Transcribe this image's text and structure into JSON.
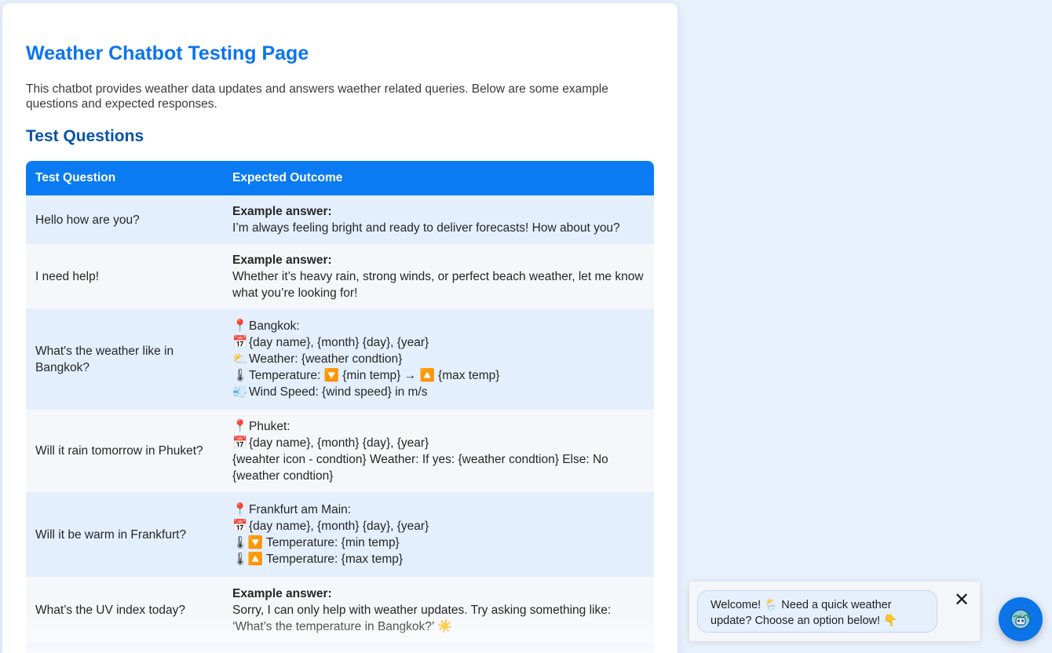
{
  "page": {
    "title": "Weather Chatbot Testing Page",
    "intro": "This chatbot provides weather data updates and answers waether related queries. Below are some example questions and expected responses.",
    "section_title": "Test Questions"
  },
  "table": {
    "headers": [
      "Test Question",
      "Expected Outcome"
    ],
    "rows": [
      {
        "question": "Hello how are you?",
        "answer_label": "Example answer:",
        "answer_lines": [
          "I’m always feeling bright and ready to deliver forecasts! How about you?"
        ]
      },
      {
        "question": "I need help!",
        "answer_label": "Example answer:",
        "answer_lines": [
          "Whether it’s heavy rain, strong winds, or perfect beach weather, let me know what you’re looking for!"
        ]
      },
      {
        "question": "What's the weather like in Bangkok?",
        "answer_lines": [
          {
            "icon": "📍",
            "text": "Bangkok:"
          },
          {
            "icon": "📅",
            "text": "{day name}, {month} {day}, {year}"
          },
          {
            "icon": "⛅",
            "text": "Weather: {weather condtion}"
          },
          {
            "icon": "🌡",
            "text": "Temperature: 🔽 {min temp} → 🔼 {max temp}"
          },
          {
            "icon": "💨",
            "text": "Wind Speed: {wind speed} in m/s"
          }
        ]
      },
      {
        "question": "Will it rain tomorrow in Phuket?",
        "answer_lines": [
          {
            "icon": "📍",
            "text": "Phuket:"
          },
          {
            "icon": "📅",
            "text": "{day name}, {month} {day}, {year}"
          },
          {
            "icon": "",
            "text": "{weahter icon - condtion} Weather: If yes: {weather condtion} Else: No {weather condtion}"
          }
        ]
      },
      {
        "question": "Will it be warm in Frankfurt?",
        "answer_lines": [
          {
            "icon": "📍",
            "text": "Frankfurt am Main:"
          },
          {
            "icon": "📅",
            "text": "{day name}, {month} {day}, {year}"
          },
          {
            "icon": "🌡🔽",
            "text": "Temperature: {min temp}"
          },
          {
            "icon": "🌡🔼",
            "text": "Temperature: {max temp}"
          }
        ]
      },
      {
        "question": "What’s the UV index today?",
        "answer_label": "Example answer:",
        "answer_lines": [
          "Sorry, I can only help with weather updates. Try asking something like: ‘What’s the temperature in Bangkok?’ ☀️"
        ]
      }
    ]
  },
  "chat": {
    "welcome": "Welcome! 🌦️ Need a quick weather update? Choose an option below! 👇",
    "close_symbol": "✕",
    "launcher_icon": "robot-globe-icon"
  },
  "colors": {
    "accent": "#0a7bf2",
    "title": "#0a74f0",
    "section": "#0653a8",
    "row_odd": "#e4effd",
    "row_even": "#f5f7fa",
    "page_bg": "#e8f0fb"
  }
}
